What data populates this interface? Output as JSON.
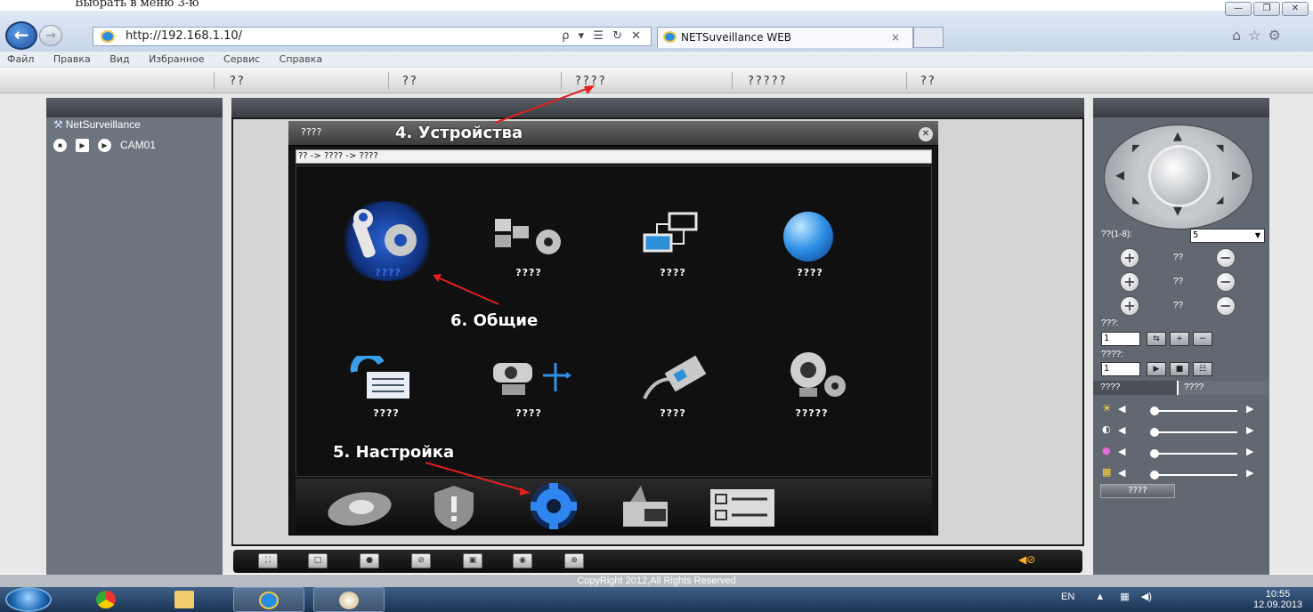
{
  "top_strip_text": "Выбрать в меню 3-ю",
  "browser": {
    "address": "http://192.168.1.10/",
    "address_tools": "ρ ▾ ☰ ↻ ✕",
    "tab_title": "NETSuveillance WEB",
    "tab_close": "×",
    "back_glyph": "←",
    "forward_glyph": "→",
    "window_buttons": [
      "—",
      "❐",
      "✕"
    ],
    "right_icons": "⌂☆⚙"
  },
  "menu": [
    "Файл",
    "Правка",
    "Вид",
    "Избранное",
    "Сервис",
    "Справка"
  ],
  "nav": [
    "??",
    "??",
    "????",
    "?????",
    "??"
  ],
  "left_panel": {
    "title": "NetSurveillance",
    "camera": "CAM01"
  },
  "dialog": {
    "title": "????",
    "close": "✕",
    "breadcrumb": "?? -> ???? -> ????",
    "icons_row1": [
      {
        "label": "????",
        "icon": "tools-icon",
        "selected": true
      },
      {
        "label": "????",
        "icon": "blocks-gear-icon",
        "selected": false
      },
      {
        "label": "????",
        "icon": "network-icon",
        "selected": false
      },
      {
        "label": "????",
        "icon": "globe-icon",
        "selected": false
      }
    ],
    "icons_row2": [
      {
        "label": "????",
        "icon": "config-list-icon"
      },
      {
        "label": "????",
        "icon": "camera-move-icon"
      },
      {
        "label": "????",
        "icon": "cable-icon"
      },
      {
        "label": "?????",
        "icon": "webcam-gear-icon"
      }
    ],
    "bottom_icons": [
      "hdd-icon",
      "shield-icon",
      "gear-icon",
      "tools-box-icon",
      "checklist-icon"
    ]
  },
  "annotations": {
    "devices": "4. Устройства",
    "general": "6. Общие",
    "settings": "5. Настройка"
  },
  "right_panel": {
    "speed_label": "??(1-8):",
    "speed_value": "5",
    "zoom_rows": [
      "??",
      "??",
      "??"
    ],
    "preset_label": "???:",
    "preset_value": "1",
    "tour_label": "????:",
    "tour_value": "1",
    "tabs": [
      "????",
      "????"
    ],
    "apply": "????"
  },
  "copyright": "CopyRight 2012,All Rights Reserved",
  "taskbar": {
    "lang": "EN",
    "time": "10:55",
    "date": "12.09.2013"
  },
  "colors": {
    "annotation_arrow": "#e02020",
    "selected_label": "#3a6df0",
    "panel_gray": "#6c7480"
  }
}
